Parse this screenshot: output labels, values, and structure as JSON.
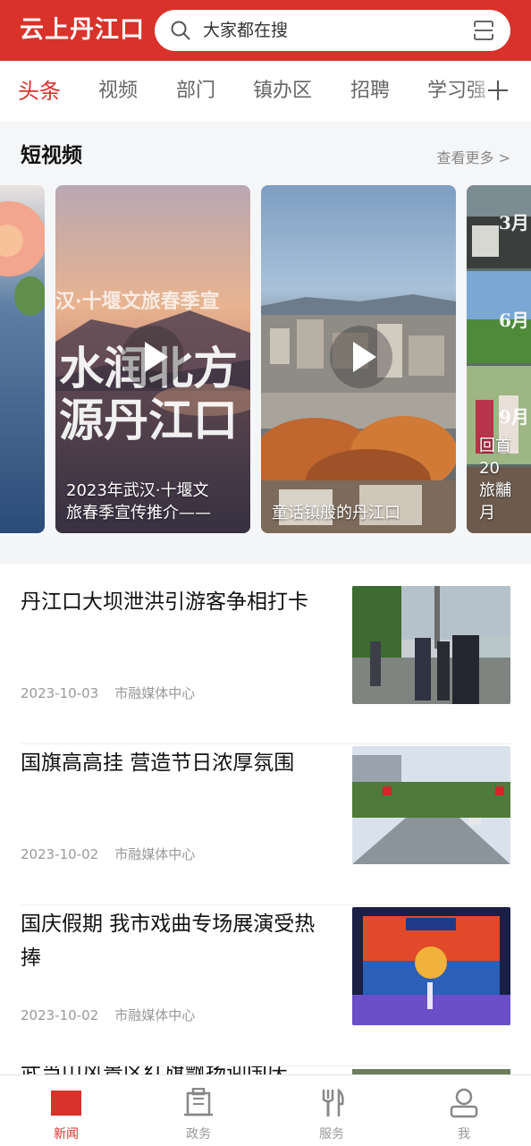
{
  "header": {
    "app_title": "云上丹江口",
    "search_placeholder": "大家都在搜",
    "brand_color": "#d8322a"
  },
  "tabs": [
    "头条",
    "视频",
    "部门",
    "镇办区",
    "招聘",
    "学习强"
  ],
  "active_tab": "头条",
  "short_video": {
    "title": "短视频",
    "more": "查看更多 >",
    "cards": [
      {
        "caption_lines": [
          "2023年武汉·十堰文",
          "旅春季宣传推介——"
        ],
        "overlay_top": "汉·十堰文旅春季宣",
        "overlay_big1": "水润北方",
        "overlay_big2": "源丹江口"
      },
      {
        "caption_lines": [
          "童话镇般的丹江口"
        ]
      },
      {
        "caption_lines": [
          "回首20",
          "旅黼月"
        ],
        "month_labels": [
          "3月",
          "6月",
          "9月"
        ]
      }
    ]
  },
  "news": [
    {
      "title": "丹江口大坝泄洪引游客争相打卡",
      "date": "2023-10-03",
      "source": "市融媒体中心"
    },
    {
      "title": "国旗高高挂 营造节日浓厚氛围",
      "date": "2023-10-02",
      "source": "市融媒体中心"
    },
    {
      "title": "国庆假期 我市戏曲专场展演受热捧",
      "date": "2023-10-02",
      "source": "市融媒体中心"
    },
    {
      "title": "武当山风景区红旗飘扬迎国庆",
      "date": "",
      "source": ""
    }
  ],
  "bottom_nav": [
    {
      "label": "新闻",
      "icon": "news-icon",
      "active": true
    },
    {
      "label": "政务",
      "icon": "building-icon",
      "active": false
    },
    {
      "label": "服务",
      "icon": "fork-knife-icon",
      "active": false
    },
    {
      "label": "我",
      "icon": "user-icon",
      "active": false
    }
  ]
}
